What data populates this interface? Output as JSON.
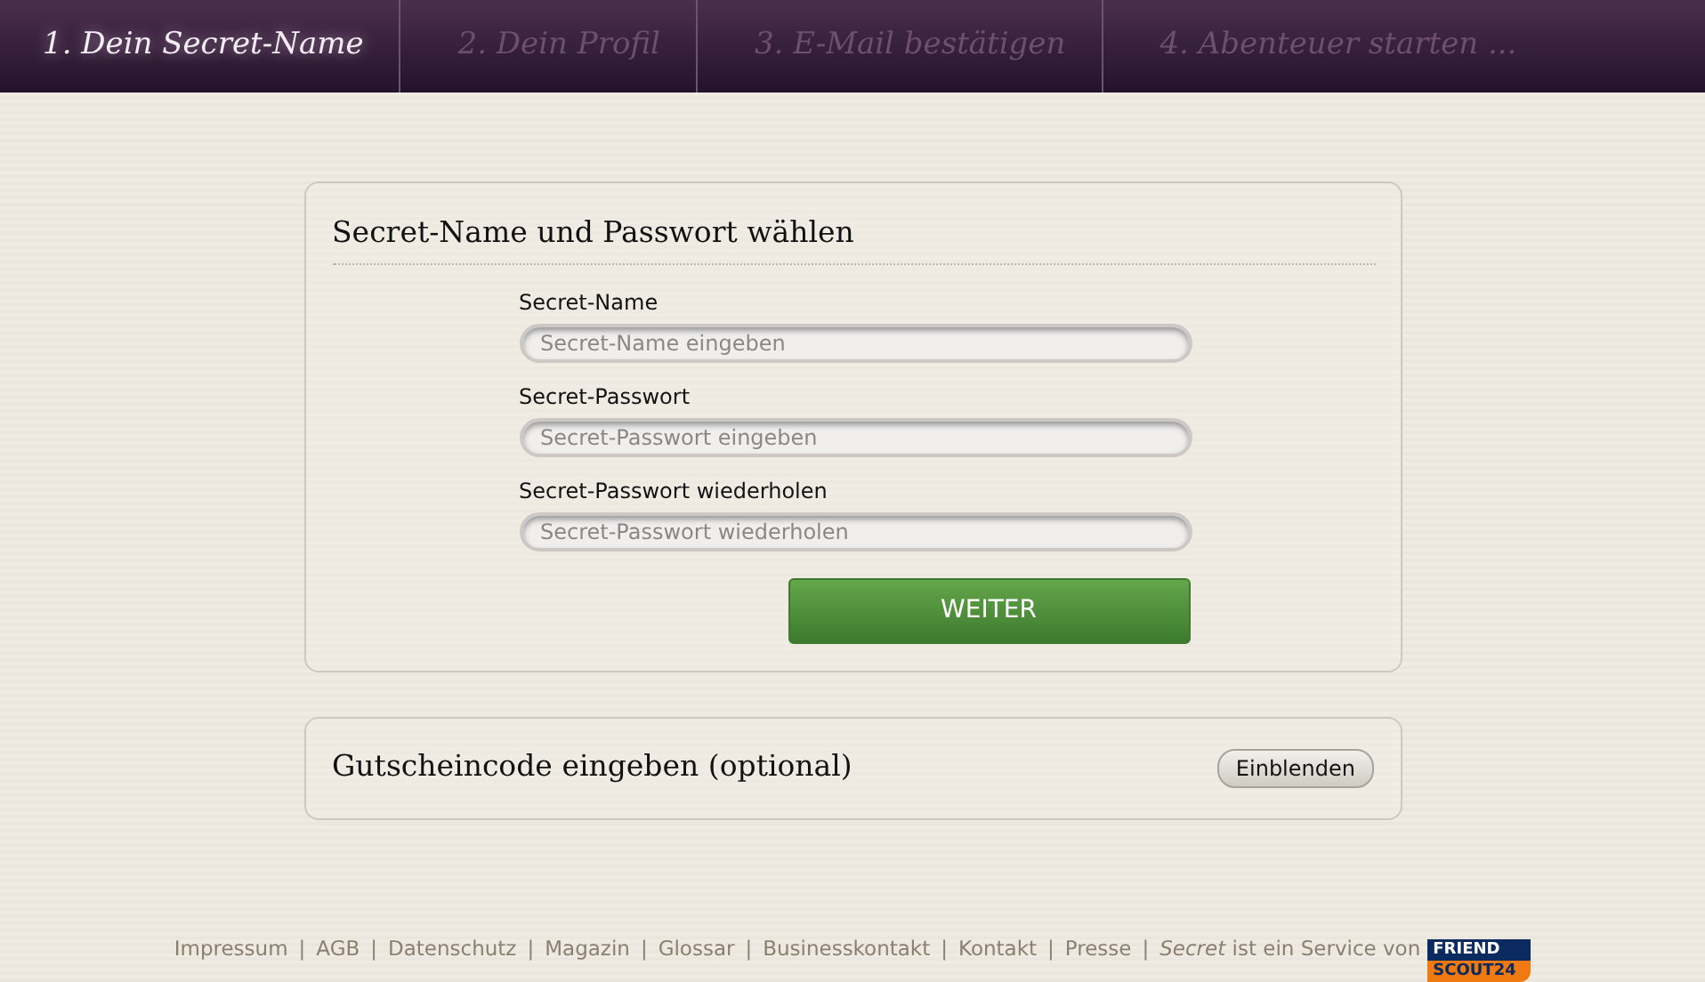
{
  "steps": [
    {
      "label": "1. Dein Secret-Name",
      "selected": true
    },
    {
      "label": "2. Dein Profil",
      "selected": false
    },
    {
      "label": "3. E-Mail bestätigen",
      "selected": false
    },
    {
      "label": "4. Abenteuer starten ...",
      "selected": false
    }
  ],
  "login_card": {
    "title": "Secret-Name und Passwort wählen",
    "fields": [
      {
        "label": "Secret-Name",
        "placeholder": "Secret-Name eingeben"
      },
      {
        "label": "Secret-Passwort",
        "placeholder": "Secret-Passwort eingeben"
      },
      {
        "label": "Secret-Passwort wiederholen",
        "placeholder": "Secret-Passwort wiederholen"
      }
    ],
    "submit": "WEITER"
  },
  "voucher_card": {
    "title": "Gutscheincode eingeben (optional)",
    "toggle": "Einblenden"
  },
  "footer": {
    "items": [
      {
        "kind": "link",
        "text": "Impressum"
      },
      {
        "kind": "sep",
        "text": "|"
      },
      {
        "kind": "link",
        "text": "AGB"
      },
      {
        "kind": "sep",
        "text": "|"
      },
      {
        "kind": "link",
        "text": "Datenschutz"
      },
      {
        "kind": "sep",
        "text": "|"
      },
      {
        "kind": "link",
        "text": "Magazin"
      },
      {
        "kind": "sep",
        "text": "|"
      },
      {
        "kind": "link",
        "text": "Glossar"
      },
      {
        "kind": "sep",
        "text": "|"
      },
      {
        "kind": "link",
        "text": "Businesskontakt"
      },
      {
        "kind": "sep",
        "text": "|"
      },
      {
        "kind": "link",
        "text": "Kontakt"
      },
      {
        "kind": "sep",
        "text": "|"
      },
      {
        "kind": "link",
        "text": "Presse"
      },
      {
        "kind": "sep",
        "text": "|"
      },
      {
        "kind": "text",
        "text": "*Secret* ist ein Service von"
      }
    ],
    "logo": [
      "FRIEND",
      "SCOUT24"
    ]
  }
}
